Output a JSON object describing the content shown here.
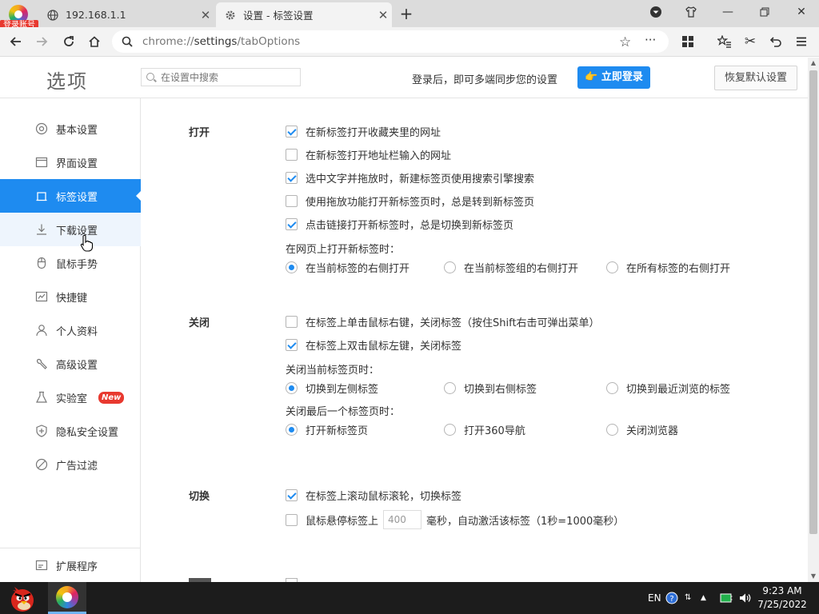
{
  "browser": {
    "login_badge": "登录账号",
    "tabs": [
      {
        "title": "192.168.1.1",
        "icon": "globe-icon"
      },
      {
        "title": "设置 - 标签设置",
        "icon": "gear-icon"
      }
    ],
    "address": {
      "scheme": "chrome://",
      "host": "settings",
      "path": "/tabOptions"
    }
  },
  "header": {
    "title": "选项",
    "search_placeholder": "在设置中搜索",
    "sync_text": "登录后，即可多端同步您的设置",
    "login_button": "立即登录",
    "reset_button": "恢复默认设置"
  },
  "sidebar": {
    "items": [
      {
        "label": "基本设置",
        "icon": "target-icon"
      },
      {
        "label": "界面设置",
        "icon": "window-icon"
      },
      {
        "label": "标签设置",
        "icon": "tab-icon"
      },
      {
        "label": "下载设置",
        "icon": "download-icon"
      },
      {
        "label": "鼠标手势",
        "icon": "mouse-icon"
      },
      {
        "label": "快捷键",
        "icon": "keyboard-icon"
      },
      {
        "label": "个人资料",
        "icon": "person-icon"
      },
      {
        "label": "高级设置",
        "icon": "wrench-icon"
      },
      {
        "label": "实验室",
        "icon": "flask-icon",
        "badge": "New"
      },
      {
        "label": "隐私安全设置",
        "icon": "shield-icon"
      },
      {
        "label": "广告过滤",
        "icon": "block-icon"
      }
    ],
    "extensions": {
      "label": "扩展程序",
      "icon": "extension-icon"
    },
    "active_index": 2,
    "hover_index": 3
  },
  "sections": {
    "open": {
      "title": "打开",
      "checkboxes": [
        {
          "label": "在新标签打开收藏夹里的网址",
          "checked": true
        },
        {
          "label": "在新标签打开地址栏输入的网址",
          "checked": false
        },
        {
          "label": "选中文字并拖放时，新建标签页使用搜索引擎搜索",
          "checked": true
        },
        {
          "label": "使用拖放功能打开新标签页时，总是转到新标签页",
          "checked": false
        },
        {
          "label": "点击链接打开新标签时，总是切换到新标签页",
          "checked": true
        }
      ],
      "position_label": "在网页上打开新标签时：",
      "position_options": [
        {
          "label": "在当前标签的右侧打开",
          "selected": true
        },
        {
          "label": "在当前标签组的右侧打开",
          "selected": false
        },
        {
          "label": "在所有标签的右侧打开",
          "selected": false
        }
      ]
    },
    "close": {
      "title": "关闭",
      "checkboxes": [
        {
          "label": "在标签上单击鼠标右键，关闭标签（按住Shift右击可弹出菜单）",
          "checked": false
        },
        {
          "label": "在标签上双击鼠标左键，关闭标签",
          "checked": true
        }
      ],
      "after_close_label": "关闭当前标签页时：",
      "after_close_options": [
        {
          "label": "切换到左侧标签",
          "selected": true
        },
        {
          "label": "切换到右侧标签",
          "selected": false
        },
        {
          "label": "切换到最近浏览的标签",
          "selected": false
        }
      ],
      "last_tab_label": "关闭最后一个标签页时：",
      "last_tab_options": [
        {
          "label": "打开新标签页",
          "selected": true
        },
        {
          "label": "打开360导航",
          "selected": false
        },
        {
          "label": "关闭浏览器",
          "selected": false
        }
      ]
    },
    "switch": {
      "title": "切换",
      "wheel_switch": {
        "label": "在标签上滚动鼠标滚轮，切换标签",
        "checked": true
      },
      "hover_switch": {
        "checked": false,
        "label_before": "鼠标悬停标签上",
        "delay_value": "400",
        "label_after": "毫秒，自动激活该标签（1秒=1000毫秒）"
      }
    }
  },
  "taskbar": {
    "lang": "EN",
    "time": "9:23 AM",
    "date": "7/25/2022"
  },
  "colors": {
    "accent": "#1e8bf0",
    "badge_red": "#e8392f"
  }
}
